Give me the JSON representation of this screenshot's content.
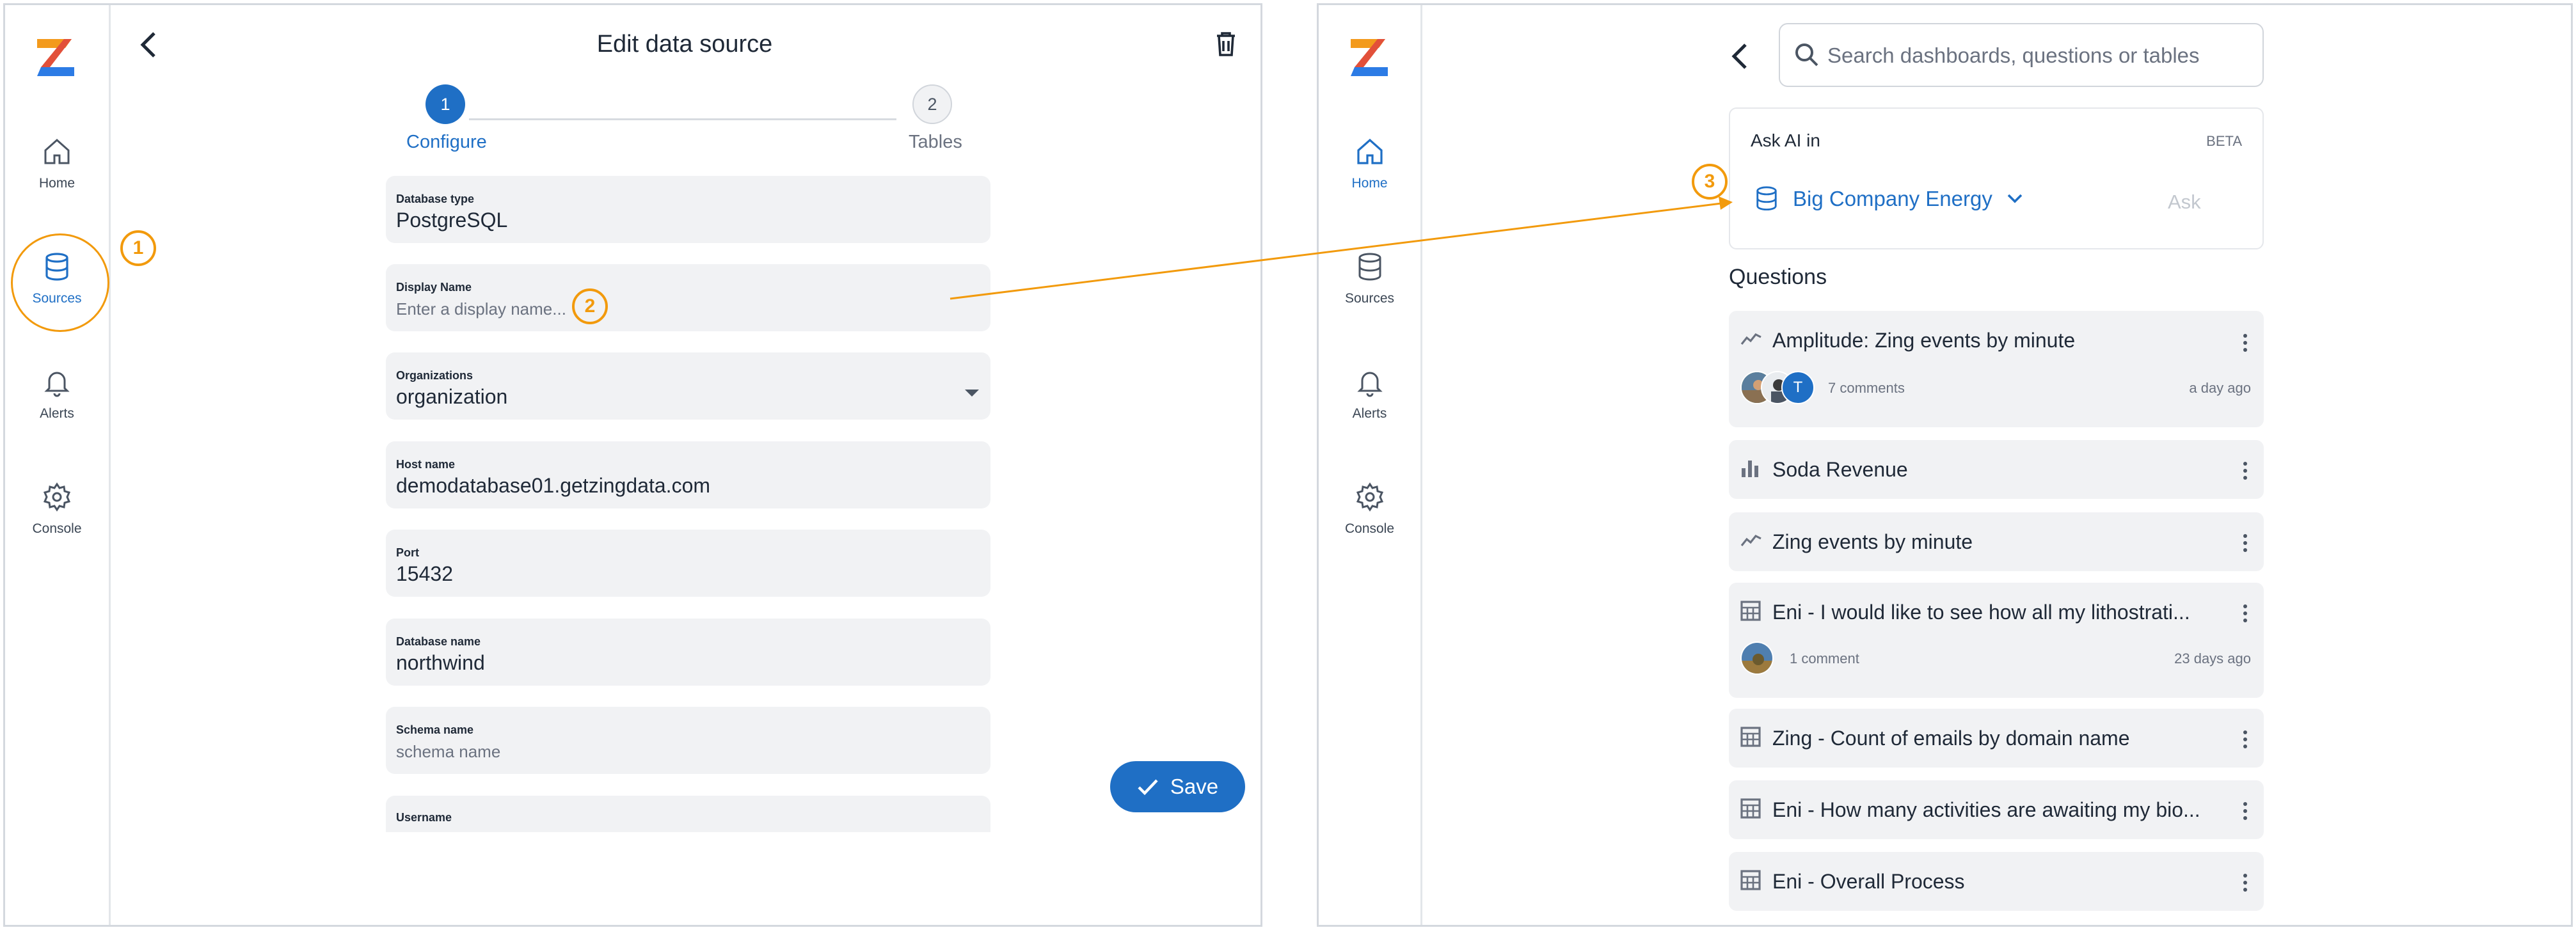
{
  "colors": {
    "accent": "#1f6fc5",
    "annotation": "#f29a0c",
    "field_bg": "#f1f2f4"
  },
  "left": {
    "sidebar": {
      "items": [
        {
          "label": "Home",
          "icon": "home-icon"
        },
        {
          "label": "Sources",
          "icon": "database-icon"
        },
        {
          "label": "Alerts",
          "icon": "bell-icon"
        },
        {
          "label": "Console",
          "icon": "gear-icon"
        }
      ]
    },
    "header": {
      "title": "Edit data source"
    },
    "stepper": [
      {
        "number": "1",
        "label": "Configure",
        "active": true
      },
      {
        "number": "2",
        "label": "Tables",
        "active": false
      }
    ],
    "form": {
      "database_type": {
        "label": "Database type",
        "value": "PostgreSQL"
      },
      "display_name": {
        "label": "Display Name",
        "placeholder": "Enter a display name..."
      },
      "organizations": {
        "label": "Organizations",
        "value": "organization"
      },
      "host_name": {
        "label": "Host name",
        "value": "demodatabase01.getzingdata.com"
      },
      "port": {
        "label": "Port",
        "value": "15432"
      },
      "database_name": {
        "label": "Database name",
        "value": "northwind"
      },
      "schema_name": {
        "label": "Schema name",
        "placeholder": "schema name"
      },
      "username": {
        "label": "Username"
      }
    },
    "save_label": "Save"
  },
  "annotations": [
    "1",
    "2",
    "3"
  ],
  "right": {
    "sidebar": {
      "items": [
        {
          "label": "Home",
          "icon": "home-icon",
          "active": true
        },
        {
          "label": "Sources",
          "icon": "database-icon"
        },
        {
          "label": "Alerts",
          "icon": "bell-icon"
        },
        {
          "label": "Console",
          "icon": "gear-icon"
        }
      ]
    },
    "search": {
      "placeholder": "Search dashboards, questions or tables"
    },
    "ask_ai": {
      "label": "Ask AI in",
      "beta": "BETA",
      "source": "Big Company Energy",
      "ask_label": "Ask"
    },
    "questions_title": "Questions",
    "questions": [
      {
        "title": "Amplitude: Zing events by minute",
        "icon": "line-chart-icon",
        "comments": "7 comments",
        "time": "a day ago",
        "avatar_initial": "T"
      },
      {
        "title": "Soda Revenue",
        "icon": "bar-chart-icon"
      },
      {
        "title": "Zing events by minute",
        "icon": "line-chart-icon"
      },
      {
        "title": "Eni - I would like to see how all my lithostrati...",
        "icon": "table-icon",
        "comments": "1 comment",
        "time": "23 days ago"
      },
      {
        "title": "Zing - Count of emails by domain name",
        "icon": "table-icon"
      },
      {
        "title": "Eni - How many activities are awaiting my bio...",
        "icon": "table-icon"
      },
      {
        "title": "Eni - Overall Process",
        "icon": "table-icon"
      }
    ]
  }
}
